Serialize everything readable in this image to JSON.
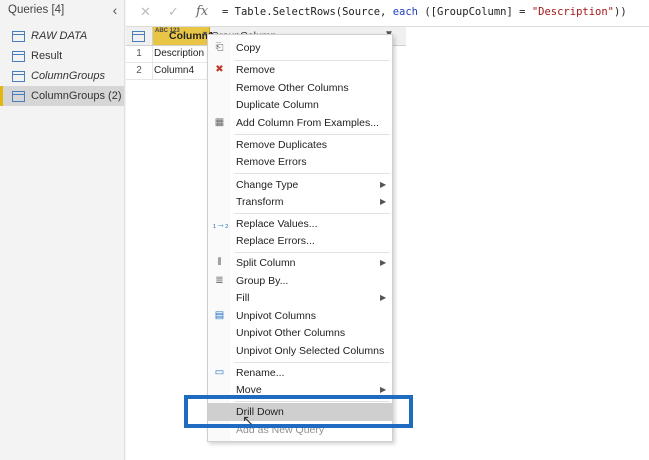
{
  "queries_pane": {
    "header": "Queries [4]",
    "collapse_icon": "chevron-left-icon",
    "items": [
      {
        "label": "RAW DATA",
        "italic": true
      },
      {
        "label": "Result",
        "italic": false
      },
      {
        "label": "ColumnGroups",
        "italic": true
      },
      {
        "label": "ColumnGroups (2)",
        "italic": false,
        "selected": true
      }
    ]
  },
  "formula_bar": {
    "cancel_icon": "close-icon",
    "confirm_icon": "check-icon",
    "fx_label": "fx",
    "formula_prefix": "= Table.SelectRows(Source,",
    "formula_keyword": "each",
    "formula_middle": "([GroupColumn] =",
    "formula_string": "\"Description\"",
    "formula_suffix": "))"
  },
  "grid": {
    "columns": [
      {
        "type_label": "ABC 123",
        "name": "Column1"
      },
      {
        "type_label": "ABC",
        "name": "GroupColumn"
      }
    ],
    "rows": [
      {
        "num": "1",
        "value": "Description"
      },
      {
        "num": "2",
        "value": "Column4"
      }
    ]
  },
  "context_menu": {
    "items": [
      {
        "label": "Copy",
        "icon": "copy-icon"
      },
      {
        "label": "Remove",
        "icon": "remove-icon"
      },
      {
        "label": "Remove Other Columns"
      },
      {
        "label": "Duplicate Column"
      },
      {
        "label": "Add Column From Examples...",
        "icon": "add-column-icon"
      },
      {
        "label": "Remove Duplicates"
      },
      {
        "label": "Remove Errors"
      },
      {
        "label": "Change Type",
        "submenu": true
      },
      {
        "label": "Transform",
        "submenu": true
      },
      {
        "label": "Replace Values...",
        "icon": "replace-values-icon"
      },
      {
        "label": "Replace Errors..."
      },
      {
        "label": "Split Column",
        "submenu": true,
        "icon": "split-column-icon"
      },
      {
        "label": "Group By...",
        "icon": "group-by-icon"
      },
      {
        "label": "Fill",
        "submenu": true
      },
      {
        "label": "Unpivot Columns",
        "icon": "unpivot-icon"
      },
      {
        "label": "Unpivot Other Columns"
      },
      {
        "label": "Unpivot Only Selected Columns"
      },
      {
        "label": "Rename...",
        "icon": "rename-icon"
      },
      {
        "label": "Move",
        "submenu": true
      },
      {
        "label": "Drill Down",
        "hover": true
      },
      {
        "label": "Add as New Query"
      }
    ]
  },
  "colors": {
    "accent_yellow": "#e9c545",
    "highlight_blue": "#1f6bc2",
    "menu_hover": "#cfcfcf"
  }
}
